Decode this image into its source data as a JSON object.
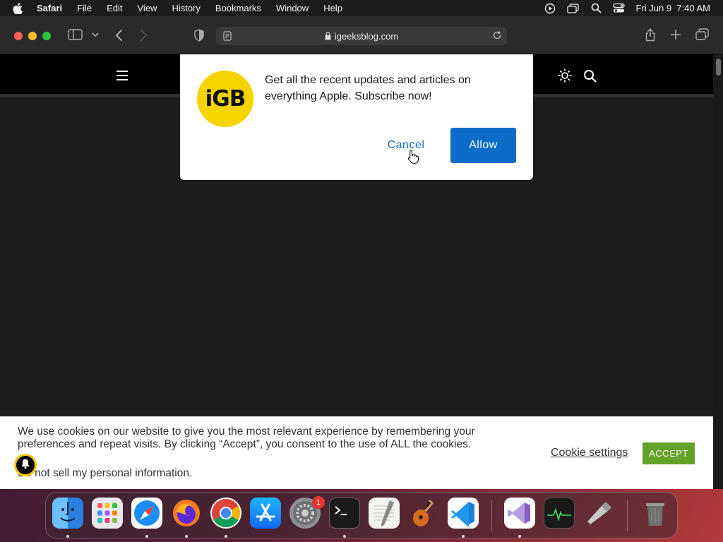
{
  "menubar": {
    "app_name": "Safari",
    "items": [
      "File",
      "Edit",
      "View",
      "History",
      "Bookmarks",
      "Window",
      "Help"
    ],
    "datetime": "Fri Jun 9  7:40 AM"
  },
  "browser": {
    "url": "igeeksblog.com"
  },
  "notification_dialog": {
    "logo_text": "iGB",
    "message": "Get all the recent updates and articles on everything Apple. Subscribe now!",
    "cancel_label": "Cancel",
    "allow_label": "Allow"
  },
  "cookie_banner": {
    "text": "We use cookies on our website to give you the most relevant experience by remembering your preferences and repeat visits. By clicking “Accept”, you consent to the use of ALL the cookies.",
    "do_not_sell": "Do not sell my personal information.",
    "settings_label": "Cookie settings",
    "accept_label": "ACCEPT"
  },
  "dock": {
    "apps": [
      "finder-icon",
      "launchpad-icon",
      "safari-icon",
      "firefox-icon",
      "chrome-icon",
      "app-store-icon",
      "system-settings-icon",
      "terminal-icon",
      "textedit-icon",
      "garageband-icon",
      "vscode-icon",
      "visual-studio-icon",
      "activity-monitor-icon",
      "usb-drive-icon",
      "trash-icon"
    ],
    "system_settings_badge": "1"
  },
  "colors": {
    "allow_button": "#0a6cc8",
    "accept_button": "#61a229",
    "logo_yellow": "#f5d400"
  }
}
